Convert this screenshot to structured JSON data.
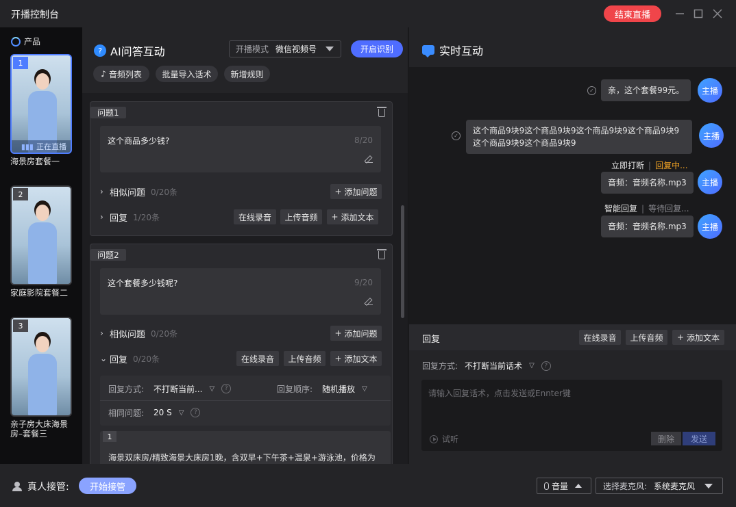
{
  "window": {
    "title": "开播控制台",
    "end_live": "结束直播"
  },
  "sidebar": {
    "header": "产品",
    "products": [
      {
        "num": "1",
        "name": "海景房套餐一",
        "live_tag": "正在直播"
      },
      {
        "num": "2",
        "name": "家庭影院套餐二"
      },
      {
        "num": "3",
        "name": "亲子房大床海景房–套餐三"
      }
    ]
  },
  "ai": {
    "title": "AI问答互动",
    "mode_label": "开播模式",
    "mode_value": "微信视频号",
    "start_recog": "开启识别",
    "chips": [
      "音频列表",
      "批量导入话术",
      "新增规则"
    ]
  },
  "questions": [
    {
      "tag": "问题1",
      "text": "这个商品多少钱?",
      "count": "8/20",
      "similar_label": "相似问题",
      "similar_count": "0/20条",
      "add_question": "添加问题",
      "reply_label": "回复",
      "reply_count": "1/20条",
      "record": "在线录音",
      "upload": "上传音频",
      "add_text": "添加文本"
    },
    {
      "tag": "问题2",
      "text": "这个套餐多少钱呢?",
      "count": "9/20",
      "similar_label": "相似问题",
      "similar_count": "0/20条",
      "add_question": "添加问题",
      "reply_label": "回复",
      "reply_count": "0/20条",
      "record": "在线录音",
      "upload": "上传音频",
      "add_text": "添加文本",
      "options": {
        "reply_mode_label": "回复方式:",
        "reply_mode_value": "不打断当前...",
        "order_label": "回复顺序:",
        "order_value": "随机播放",
        "same_label": "相同问题:",
        "same_value": "20 S"
      },
      "reply_item": {
        "num": "1",
        "text": "海景双床房/精致海景大床房1晚，含双早+下午茶+温泉+游泳池，价格为"
      }
    }
  ],
  "realtime": {
    "title": "实时互动",
    "messages": [
      {
        "text": "亲，这个套餐99元。",
        "avatar": "主播"
      },
      {
        "text_line1": "这个商品9块9这个商品9块9这个商品9块9这个商品9块9",
        "text_line2": "这个商品9块9这个商品9块9",
        "avatar": "主播"
      },
      {
        "meta_type": "立即打断",
        "meta_state": "回复中...",
        "text": "音频：音频名称.mp3",
        "avatar": "主播"
      },
      {
        "meta_type": "智能回复",
        "meta_state": "等待回复...",
        "text": "音频：音频名称.mp3",
        "avatar": "主播"
      }
    ],
    "reply_bar": {
      "label": "回复",
      "record": "在线录音",
      "upload": "上传音频",
      "add_text": "添加文本"
    },
    "reply_panel": {
      "mode_label": "回复方式:",
      "mode_value": "不打断当前话术",
      "placeholder": "请输入回复话术，点击发送或Ennter键",
      "listen": "试听",
      "delete": "删除",
      "send": "发送"
    }
  },
  "bottom": {
    "human_label": "真人接管:",
    "start_take": "开始接管",
    "volume": "音量",
    "mic_label": "选择麦克风:",
    "mic_value": "系统麦克风"
  },
  "colors": {
    "accent": "#4f6dff",
    "danger": "#f0454a",
    "state_orange": "#f5a524"
  }
}
